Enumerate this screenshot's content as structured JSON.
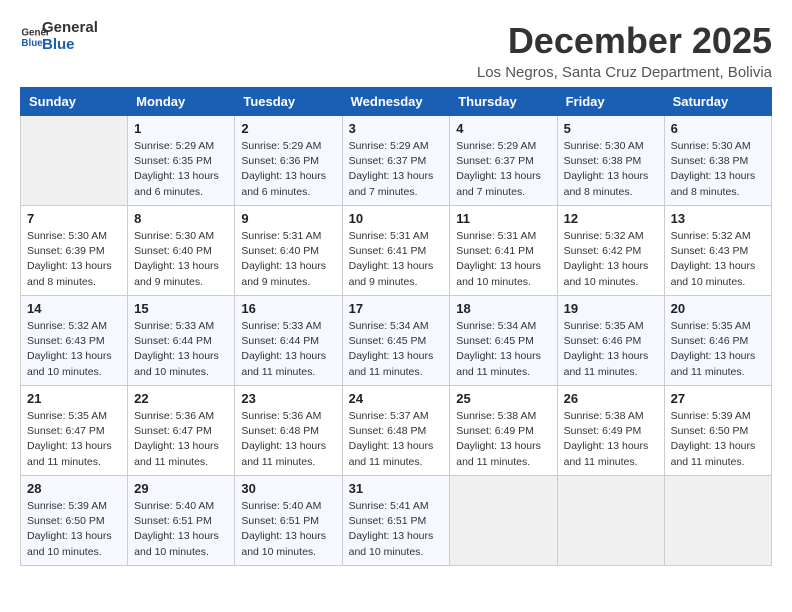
{
  "logo": {
    "line1": "General",
    "line2": "Blue"
  },
  "title": "December 2025",
  "subtitle": "Los Negros, Santa Cruz Department, Bolivia",
  "weekdays": [
    "Sunday",
    "Monday",
    "Tuesday",
    "Wednesday",
    "Thursday",
    "Friday",
    "Saturday"
  ],
  "weeks": [
    [
      {
        "day": "",
        "info": ""
      },
      {
        "day": "1",
        "info": "Sunrise: 5:29 AM\nSunset: 6:35 PM\nDaylight: 13 hours\nand 6 minutes."
      },
      {
        "day": "2",
        "info": "Sunrise: 5:29 AM\nSunset: 6:36 PM\nDaylight: 13 hours\nand 6 minutes."
      },
      {
        "day": "3",
        "info": "Sunrise: 5:29 AM\nSunset: 6:37 PM\nDaylight: 13 hours\nand 7 minutes."
      },
      {
        "day": "4",
        "info": "Sunrise: 5:29 AM\nSunset: 6:37 PM\nDaylight: 13 hours\nand 7 minutes."
      },
      {
        "day": "5",
        "info": "Sunrise: 5:30 AM\nSunset: 6:38 PM\nDaylight: 13 hours\nand 8 minutes."
      },
      {
        "day": "6",
        "info": "Sunrise: 5:30 AM\nSunset: 6:38 PM\nDaylight: 13 hours\nand 8 minutes."
      }
    ],
    [
      {
        "day": "7",
        "info": "Sunrise: 5:30 AM\nSunset: 6:39 PM\nDaylight: 13 hours\nand 8 minutes."
      },
      {
        "day": "8",
        "info": "Sunrise: 5:30 AM\nSunset: 6:40 PM\nDaylight: 13 hours\nand 9 minutes."
      },
      {
        "day": "9",
        "info": "Sunrise: 5:31 AM\nSunset: 6:40 PM\nDaylight: 13 hours\nand 9 minutes."
      },
      {
        "day": "10",
        "info": "Sunrise: 5:31 AM\nSunset: 6:41 PM\nDaylight: 13 hours\nand 9 minutes."
      },
      {
        "day": "11",
        "info": "Sunrise: 5:31 AM\nSunset: 6:41 PM\nDaylight: 13 hours\nand 10 minutes."
      },
      {
        "day": "12",
        "info": "Sunrise: 5:32 AM\nSunset: 6:42 PM\nDaylight: 13 hours\nand 10 minutes."
      },
      {
        "day": "13",
        "info": "Sunrise: 5:32 AM\nSunset: 6:43 PM\nDaylight: 13 hours\nand 10 minutes."
      }
    ],
    [
      {
        "day": "14",
        "info": "Sunrise: 5:32 AM\nSunset: 6:43 PM\nDaylight: 13 hours\nand 10 minutes."
      },
      {
        "day": "15",
        "info": "Sunrise: 5:33 AM\nSunset: 6:44 PM\nDaylight: 13 hours\nand 10 minutes."
      },
      {
        "day": "16",
        "info": "Sunrise: 5:33 AM\nSunset: 6:44 PM\nDaylight: 13 hours\nand 11 minutes."
      },
      {
        "day": "17",
        "info": "Sunrise: 5:34 AM\nSunset: 6:45 PM\nDaylight: 13 hours\nand 11 minutes."
      },
      {
        "day": "18",
        "info": "Sunrise: 5:34 AM\nSunset: 6:45 PM\nDaylight: 13 hours\nand 11 minutes."
      },
      {
        "day": "19",
        "info": "Sunrise: 5:35 AM\nSunset: 6:46 PM\nDaylight: 13 hours\nand 11 minutes."
      },
      {
        "day": "20",
        "info": "Sunrise: 5:35 AM\nSunset: 6:46 PM\nDaylight: 13 hours\nand 11 minutes."
      }
    ],
    [
      {
        "day": "21",
        "info": "Sunrise: 5:35 AM\nSunset: 6:47 PM\nDaylight: 13 hours\nand 11 minutes."
      },
      {
        "day": "22",
        "info": "Sunrise: 5:36 AM\nSunset: 6:47 PM\nDaylight: 13 hours\nand 11 minutes."
      },
      {
        "day": "23",
        "info": "Sunrise: 5:36 AM\nSunset: 6:48 PM\nDaylight: 13 hours\nand 11 minutes."
      },
      {
        "day": "24",
        "info": "Sunrise: 5:37 AM\nSunset: 6:48 PM\nDaylight: 13 hours\nand 11 minutes."
      },
      {
        "day": "25",
        "info": "Sunrise: 5:38 AM\nSunset: 6:49 PM\nDaylight: 13 hours\nand 11 minutes."
      },
      {
        "day": "26",
        "info": "Sunrise: 5:38 AM\nSunset: 6:49 PM\nDaylight: 13 hours\nand 11 minutes."
      },
      {
        "day": "27",
        "info": "Sunrise: 5:39 AM\nSunset: 6:50 PM\nDaylight: 13 hours\nand 11 minutes."
      }
    ],
    [
      {
        "day": "28",
        "info": "Sunrise: 5:39 AM\nSunset: 6:50 PM\nDaylight: 13 hours\nand 10 minutes."
      },
      {
        "day": "29",
        "info": "Sunrise: 5:40 AM\nSunset: 6:51 PM\nDaylight: 13 hours\nand 10 minutes."
      },
      {
        "day": "30",
        "info": "Sunrise: 5:40 AM\nSunset: 6:51 PM\nDaylight: 13 hours\nand 10 minutes."
      },
      {
        "day": "31",
        "info": "Sunrise: 5:41 AM\nSunset: 6:51 PM\nDaylight: 13 hours\nand 10 minutes."
      },
      {
        "day": "",
        "info": ""
      },
      {
        "day": "",
        "info": ""
      },
      {
        "day": "",
        "info": ""
      }
    ]
  ]
}
